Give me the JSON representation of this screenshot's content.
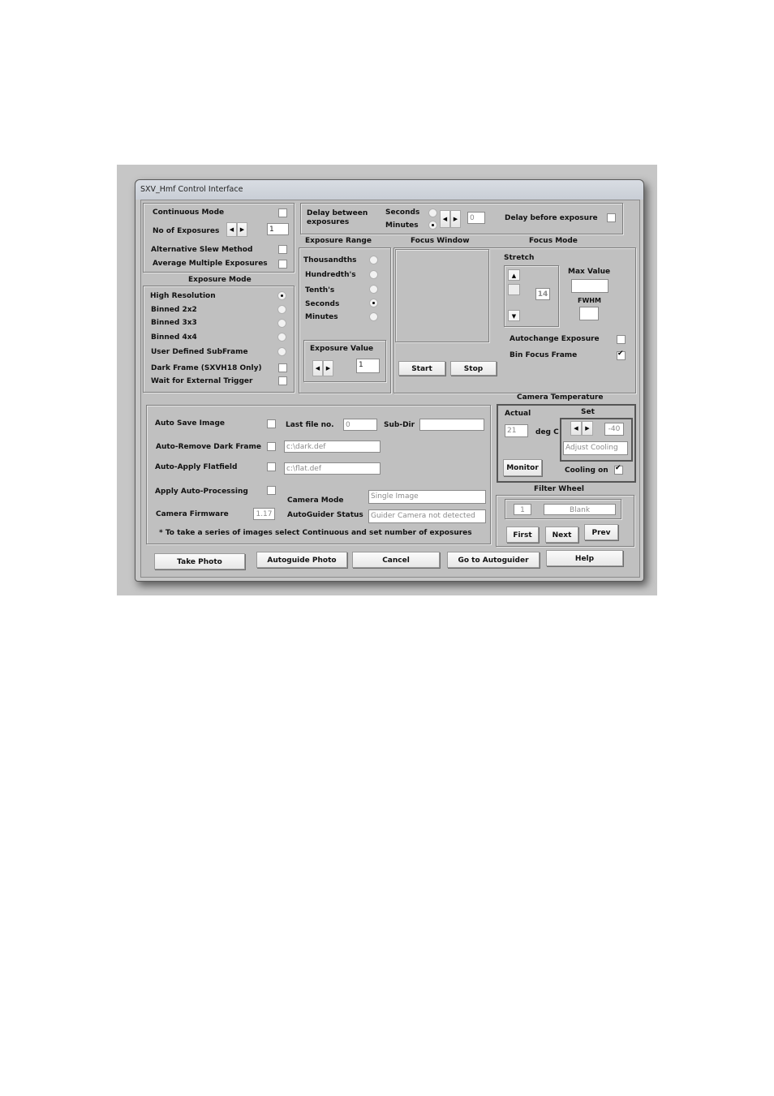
{
  "window": {
    "title": "SXV_Hmf Control Interface"
  },
  "top_left": {
    "continuous_mode": {
      "label": "Continuous Mode",
      "checked": false
    },
    "no_of_exposures": {
      "label": "No of Exposures",
      "value": "1"
    },
    "alt_slew": {
      "label": "Alternative Slew Method",
      "checked": false
    },
    "avg_multiple": {
      "label": "Average Multiple Exposures",
      "checked": false
    }
  },
  "exposure_mode": {
    "title": "Exposure Mode",
    "options": [
      {
        "label": "High Resolution",
        "selected": true
      },
      {
        "label": "Binned 2x2",
        "selected": false
      },
      {
        "label": "Binned 3x3",
        "selected": false
      },
      {
        "label": "Binned 4x4",
        "selected": false
      },
      {
        "label": "User Defined SubFrame",
        "selected": false
      }
    ],
    "dark_frame": {
      "label": "Dark Frame (SXVH18 Only)",
      "checked": false
    },
    "wait_trigger": {
      "label": "Wait for External Trigger",
      "checked": false
    }
  },
  "delay": {
    "label": "Delay between exposures",
    "seconds_label": "Seconds",
    "minutes_label": "Minutes",
    "unit_selected": "Minutes",
    "value": "0",
    "before_label": "Delay before exposure",
    "before_checked": false
  },
  "exposure_range": {
    "title": "Exposure Range",
    "options": [
      {
        "label": "Thousandths",
        "selected": false
      },
      {
        "label": "Hundredth's",
        "selected": false
      },
      {
        "label": "Tenth's",
        "selected": false
      },
      {
        "label": "Seconds",
        "selected": true
      },
      {
        "label": "Minutes",
        "selected": false
      }
    ],
    "value_title": "Exposure Value",
    "value": "1"
  },
  "focus": {
    "window_title": "Focus Window",
    "mode_title": "Focus Mode",
    "stretch_label": "Stretch",
    "stretch_value": "14",
    "max_value_label": "Max Value",
    "max_value": "",
    "fwhm_label": "FWHM",
    "fwhm": "",
    "autochange_label": "Autochange Exposure",
    "autochange_checked": false,
    "bin_focus_label": "Bin Focus Frame",
    "bin_focus_checked": true,
    "start_label": "Start",
    "stop_label": "Stop"
  },
  "save": {
    "auto_save_label": "Auto Save Image",
    "auto_save_checked": false,
    "last_file_label": "Last file no.",
    "last_file_value": "0",
    "subdir_label": "Sub-Dir",
    "subdir_value": "",
    "dark_label": "Auto-Remove Dark Frame",
    "dark_checked": false,
    "dark_path": "c:\\dark.def",
    "flat_label": "Auto-Apply Flatfield",
    "flat_checked": false,
    "flat_path": "c:\\flat.def",
    "autoproc_label": "Apply Auto-Processing",
    "autoproc_checked": false,
    "firmware_label": "Camera Firmware",
    "firmware_value": "1.17",
    "camera_mode_label": "Camera Mode",
    "camera_mode_value": "Single Image",
    "guider_status_label": "AutoGuider Status",
    "guider_status_value": "Guider Camera not detected",
    "note": "* To take a series of images select Continuous and set number of exposures"
  },
  "temperature": {
    "title": "Camera Temperature",
    "actual_label": "Actual",
    "actual_value": "21",
    "unit_label": "deg C",
    "set_label": "Set",
    "set_value": "-40",
    "adjust_label": "Adjust Cooling",
    "monitor_label": "Monitor",
    "cooling_label": "Cooling on",
    "cooling_checked": true
  },
  "filter_wheel": {
    "title": "Filter Wheel",
    "position": "1",
    "filter_name": "Blank",
    "first_label": "First",
    "next_label": "Next",
    "prev_label": "Prev"
  },
  "bottom_buttons": {
    "take_photo": "Take Photo",
    "autoguide_photo": "Autoguide Photo",
    "cancel": "Cancel",
    "go_autoguider": "Go to Autoguider",
    "help": "Help"
  }
}
